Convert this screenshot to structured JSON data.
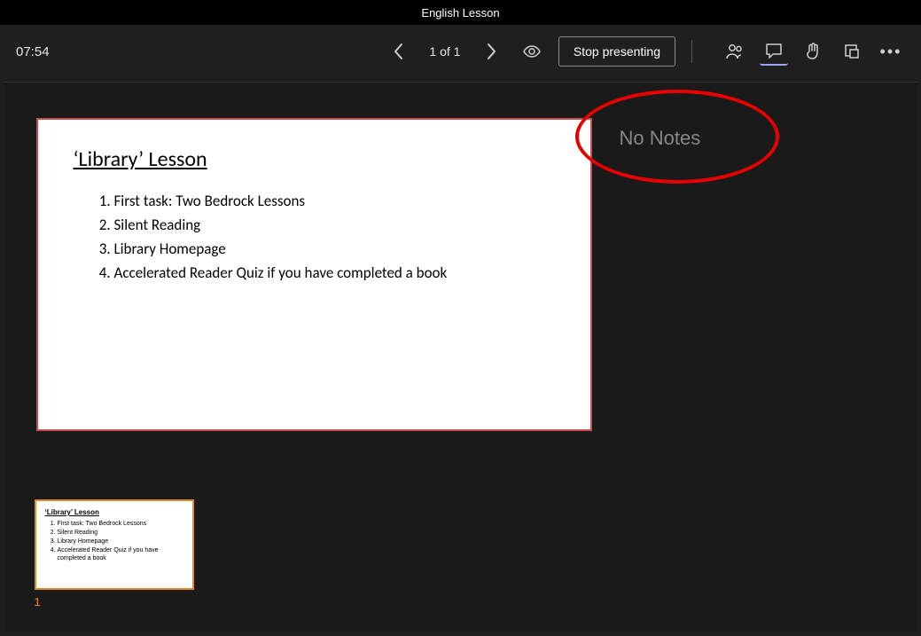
{
  "titlebar": {
    "title": "English Lesson"
  },
  "toolbar": {
    "timer": "07:54",
    "page_indicator": "1 of 1",
    "stop_label": "Stop presenting"
  },
  "notes": {
    "placeholder": "No Notes"
  },
  "slide": {
    "title": "‘Library’ Lesson",
    "items": [
      "First task: Two Bedrock Lessons",
      "Silent Reading",
      "Library Homepage",
      "Accelerated Reader Quiz if you have completed a book"
    ]
  },
  "thumbnail": {
    "number": "1",
    "title": "‘Library’ Lesson",
    "items": [
      "First task: Two Bedrock Lessons",
      "Silent Reading",
      "Library Homepage",
      "Accelerated Reader Quiz if you have completed a book"
    ]
  }
}
